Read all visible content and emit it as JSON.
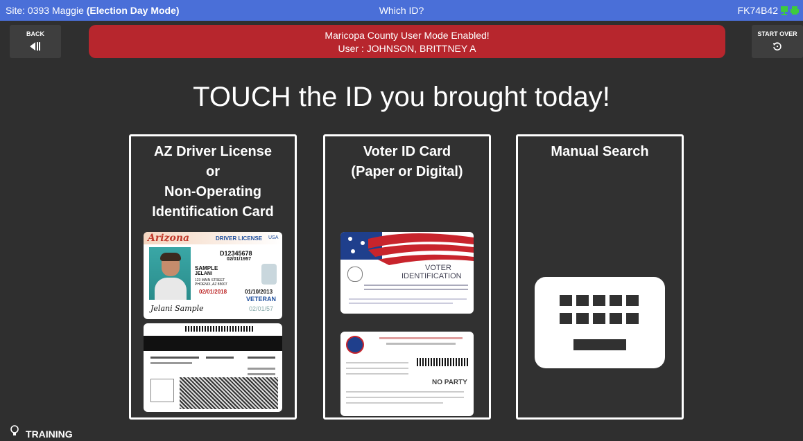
{
  "header": {
    "site_prefix": "Site: 0393 Maggie ",
    "mode": "(Election Day Mode)",
    "title": "Which ID?",
    "device_id": "FK74B42"
  },
  "toolbar": {
    "back_label": "BACK",
    "start_over_label": "START OVER"
  },
  "banner": {
    "line1": "Maricopa County User Mode Enabled!",
    "line2": "User : JOHNSON, BRITTNEY A"
  },
  "headline": "TOUCH the ID you brought today!",
  "options": [
    {
      "lines": [
        "AZ Driver License",
        "or",
        "Non-Operating",
        "Identification Card"
      ]
    },
    {
      "lines": [
        "Voter ID Card",
        "(Paper or Digital)"
      ]
    },
    {
      "lines": [
        "Manual Search"
      ]
    }
  ],
  "dl": {
    "state": "Arizona",
    "type": "DRIVER LICENSE",
    "country": "USA",
    "number": "D12345678",
    "dob": "02/01/1957",
    "name1": "SAMPLE",
    "name2": "JELANI",
    "addr1": "123 MAIN STREET",
    "addr2": "PHOENIX, AZ 85007",
    "exp": "02/01/2018",
    "iss": "01/10/2013",
    "veteran": "VETERAN",
    "small_date": "02/01/57",
    "signature": "Jelani Sample"
  },
  "voter": {
    "line1": "VOTER",
    "line2": "IDENTIFICATION",
    "party": "NO PARTY"
  },
  "footer": {
    "training": "TRAINING"
  },
  "colors": {
    "topbar": "#4a6fd8",
    "banner": "#b7262d",
    "background": "#2f2f2f"
  }
}
